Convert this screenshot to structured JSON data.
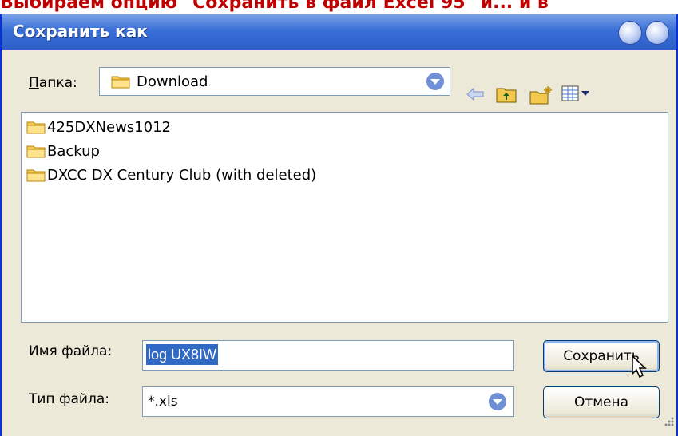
{
  "caption": "Выбираем опцию \"Сохранить в файл Excel 95\" и... и в",
  "dialog": {
    "title": "Сохранить как",
    "folder_label": "Папка:",
    "folder_value": "Download",
    "files": [
      {
        "name": "425DXNews1012"
      },
      {
        "name": "Backup"
      },
      {
        "name": "DXCC DX Century Club (with deleted)"
      }
    ],
    "filename_label": "Имя файла:",
    "filename_value": "log UX8IW",
    "filetype_label": "Тип файла:",
    "filetype_value": "*.xls",
    "save_button": "Сохранить",
    "cancel_button": "Отмена"
  },
  "colors": {
    "selection": "#316ac5",
    "titlebar": "#2d5fc7"
  },
  "icons": [
    "folder-icon",
    "back-arrow-icon",
    "up-folder-icon",
    "new-folder-icon",
    "view-menu-icon",
    "dropdown-arrow-icon",
    "mouse-cursor-icon"
  ]
}
